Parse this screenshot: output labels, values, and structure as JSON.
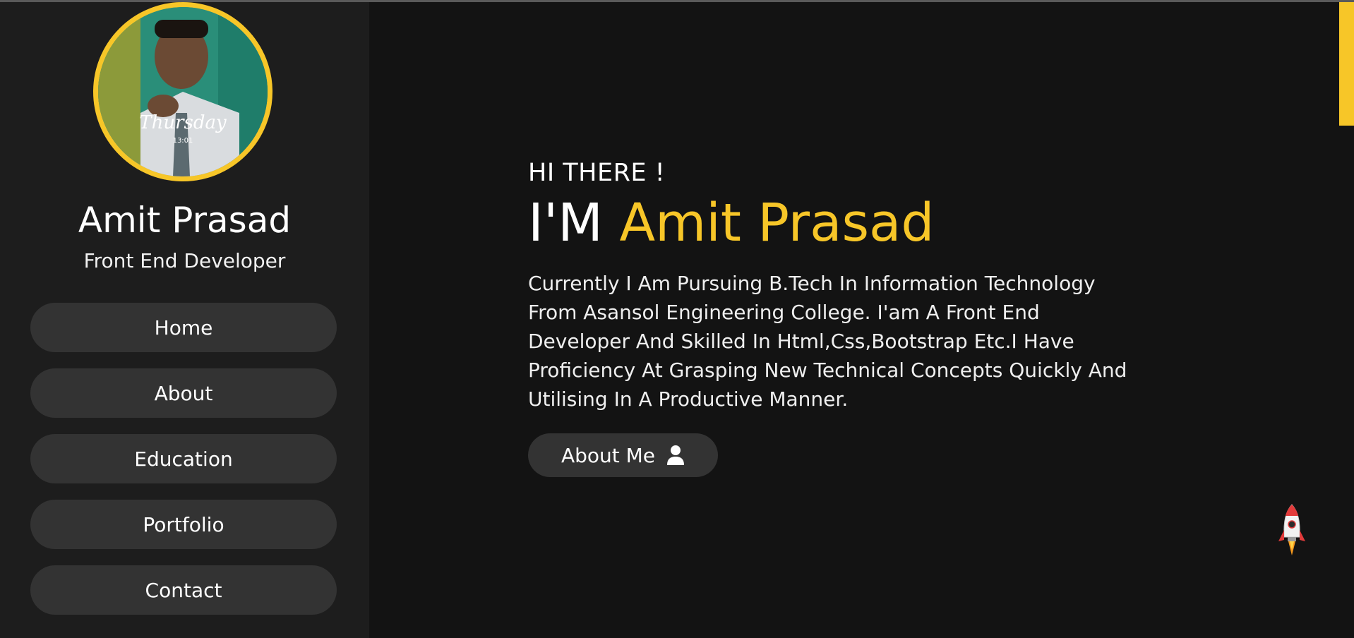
{
  "profile": {
    "name": "Amit Prasad",
    "role": "Front End Developer",
    "avatar_overlay_text": "Thursday",
    "avatar_overlay_time": "13:01"
  },
  "nav": {
    "items": [
      {
        "label": "Home"
      },
      {
        "label": "About"
      },
      {
        "label": "Education"
      },
      {
        "label": "Portfolio"
      },
      {
        "label": "Contact"
      }
    ]
  },
  "hero": {
    "greeting": "HI THERE !",
    "im_prefix": "I'M",
    "name": "Amit Prasad",
    "bio": "Currently I Am Pursuing B.Tech In Information Technology From Asansol Engineering College. I'am A Front End Developer And Skilled In Html,Css,Bootstrap Etc.I Have Proficiency At Grasping New Technical Concepts Quickly And Utilising In A Productive Manner.",
    "button_label": "About Me",
    "button_icon": "user-icon"
  },
  "colors": {
    "accent": "#f7c628",
    "background": "#131313",
    "sidebar": "#1d1d1d",
    "pill": "#333333"
  },
  "widgets": {
    "back_to_top_icon": "rocket-icon"
  }
}
